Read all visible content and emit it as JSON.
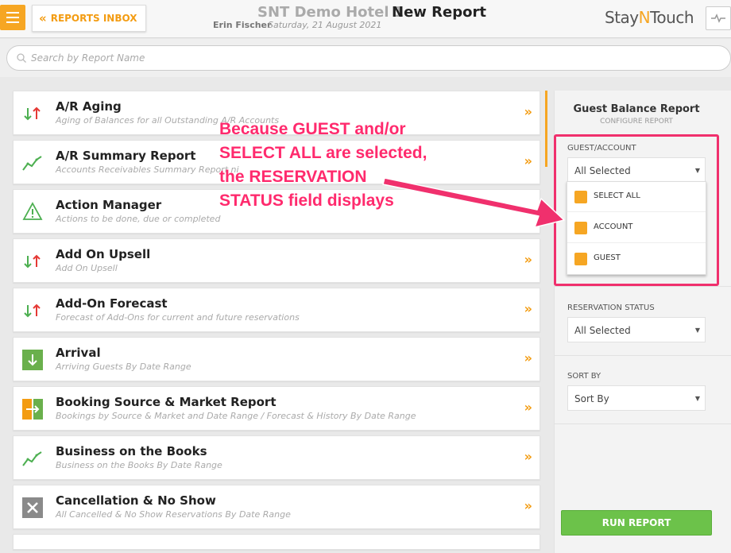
{
  "header": {
    "inbox_label": "REPORTS INBOX",
    "hotel_name": "SNT Demo Hotel 1",
    "page_title": "New Report",
    "user": "Erin Fischer",
    "date": "Saturday, 21 August 2021",
    "logo_a": "Stay",
    "logo_b": "N",
    "logo_c": "Touch",
    "accent": "#f6a623"
  },
  "search": {
    "placeholder": "Search by Report Name"
  },
  "reports": [
    {
      "name": "A/R Aging",
      "desc": "Aging of Balances for all Outstanding A/R Accounts",
      "icon": "up-down-arrows-icon"
    },
    {
      "name": "A/R Summary Report",
      "desc": "Accounts Receivables Summary Report ni",
      "icon": "trend-chart-icon"
    },
    {
      "name": "Action Manager",
      "desc": "Actions to be done, due or completed",
      "icon": "warning-triangle-icon"
    },
    {
      "name": "Add On Upsell",
      "desc": "Add On Upsell",
      "icon": "up-down-arrows-icon"
    },
    {
      "name": "Add-On Forecast",
      "desc": "Forecast of Add-Ons for current and future reservations",
      "icon": "up-down-arrows-icon"
    },
    {
      "name": "Arrival",
      "desc": "Arriving Guests By Date Range",
      "icon": "arrival-down-icon"
    },
    {
      "name": "Booking Source & Market Report",
      "desc": "Bookings by Source & Market and Date Range / Forecast & History By Date Range",
      "icon": "booking-source-icon"
    },
    {
      "name": "Business on the Books",
      "desc": "Business on the Books By Date Range",
      "icon": "trend-chart-icon"
    },
    {
      "name": "Cancellation & No Show",
      "desc": "All Cancelled & No Show Reservations By Date Range",
      "icon": "cancel-x-icon"
    }
  ],
  "panel": {
    "title": "Guest Balance Report",
    "subtitle": "CONFIGURE REPORT",
    "guest_account_label": "GUEST/ACCOUNT",
    "guest_account_value": "All Selected",
    "options": [
      "SELECT ALL",
      "ACCOUNT",
      "GUEST"
    ],
    "reservation_status_label": "RESERVATION STATUS",
    "reservation_status_value": "All Selected",
    "sort_label": "SORT BY",
    "sort_value": "Sort By",
    "run_label": "RUN REPORT"
  },
  "annotation": {
    "line1": "Because GUEST and/or",
    "line2": "SELECT ALL are selected,",
    "line3": "the RESERVATION",
    "line4": "STATUS field displays",
    "color": "#ff2a6d"
  }
}
